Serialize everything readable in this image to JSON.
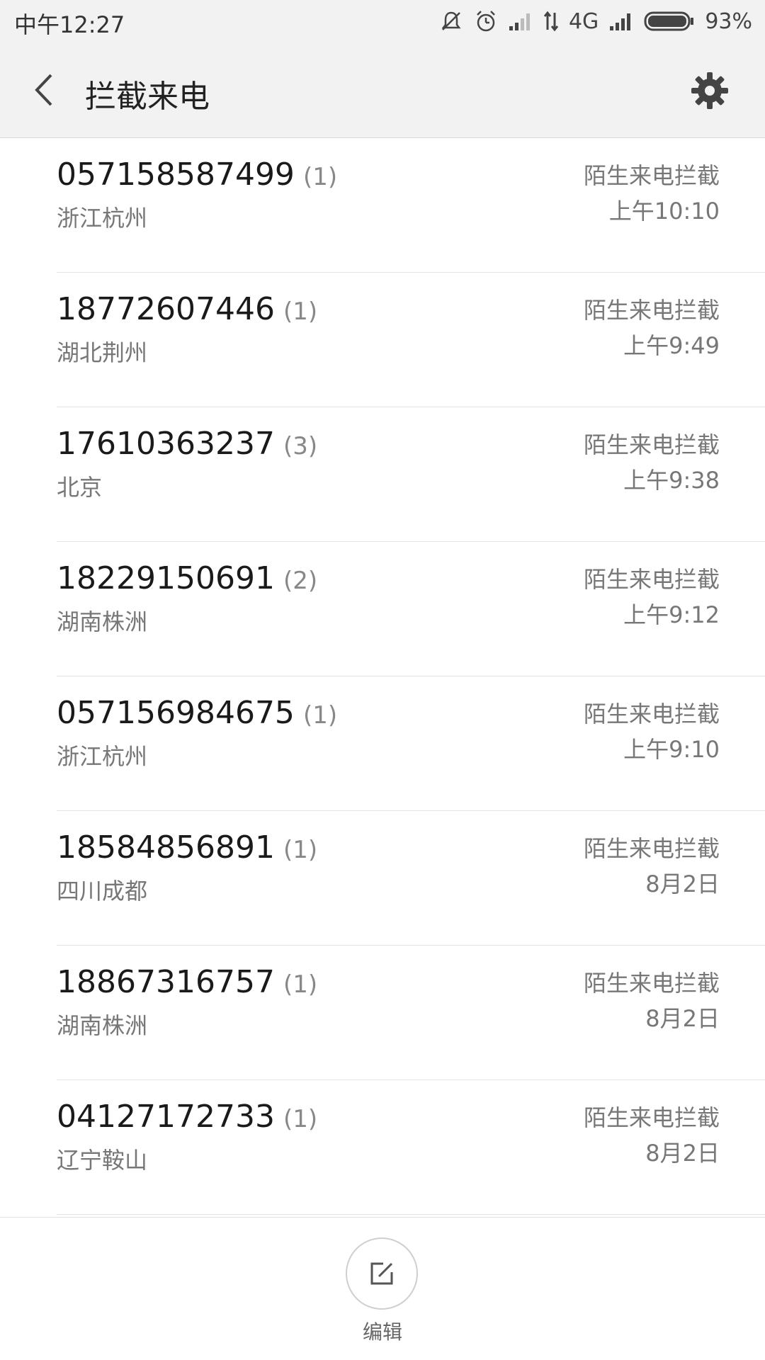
{
  "status_bar": {
    "time": "中午12:27",
    "network": "4G",
    "battery": "93%"
  },
  "header": {
    "title": "拦截来电"
  },
  "calls": [
    {
      "number": "057158587499",
      "count": "(1)",
      "location": "浙江杭州",
      "tag": "陌生来电拦截",
      "time": "上午10:10"
    },
    {
      "number": "18772607446",
      "count": "(1)",
      "location": "湖北荆州",
      "tag": "陌生来电拦截",
      "time": "上午9:49"
    },
    {
      "number": "17610363237",
      "count": "(3)",
      "location": "北京",
      "tag": "陌生来电拦截",
      "time": "上午9:38"
    },
    {
      "number": "18229150691",
      "count": "(2)",
      "location": "湖南株洲",
      "tag": "陌生来电拦截",
      "time": "上午9:12"
    },
    {
      "number": "057156984675",
      "count": "(1)",
      "location": "浙江杭州",
      "tag": "陌生来电拦截",
      "time": "上午9:10"
    },
    {
      "number": "18584856891",
      "count": "(1)",
      "location": "四川成都",
      "tag": "陌生来电拦截",
      "time": "8月2日"
    },
    {
      "number": "18867316757",
      "count": "(1)",
      "location": "湖南株洲",
      "tag": "陌生来电拦截",
      "time": "8月2日"
    },
    {
      "number": "04127172733",
      "count": "(1)",
      "location": "辽宁鞍山",
      "tag": "陌生来电拦截",
      "time": "8月2日"
    }
  ],
  "toolbar": {
    "edit_label": "编辑"
  },
  "icons": {
    "back": "chevron-left-icon",
    "settings": "gear-icon",
    "edit": "edit-icon",
    "mute": "mute-icon",
    "alarm": "alarm-icon",
    "signal": "signal-icon",
    "data": "data-arrows-icon",
    "battery": "battery-icon"
  },
  "colors": {
    "header_bg": "#f2f2f2",
    "text_primary": "#1a1a1a",
    "text_secondary": "#777777"
  }
}
